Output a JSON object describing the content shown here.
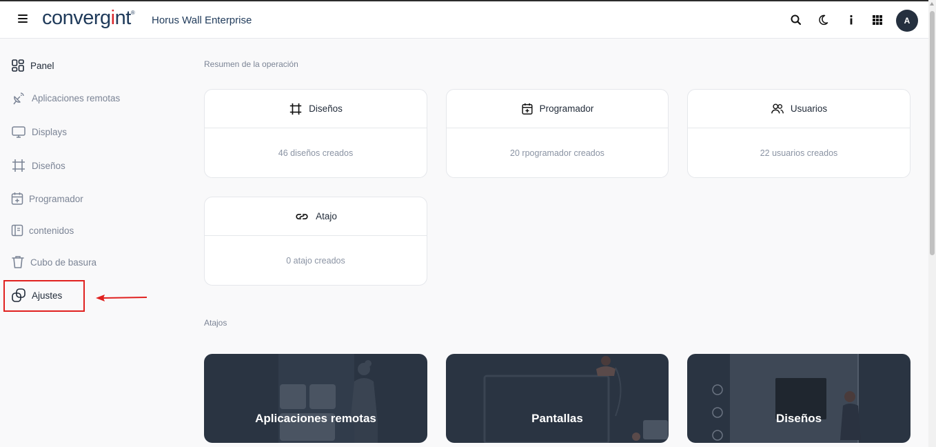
{
  "header": {
    "logo_prefix": "converg",
    "logo_accent": "i",
    "logo_suffix": "nt",
    "logo_mark": "®",
    "app_title": "Horus Wall Enterprise",
    "avatar_letter": "A"
  },
  "sidebar": {
    "items": [
      {
        "label": "Panel",
        "icon": "dashboard-icon"
      },
      {
        "label": "Aplicaciones remotas",
        "icon": "satellite-dish-icon"
      },
      {
        "label": "Displays",
        "icon": "monitor-icon"
      },
      {
        "label": "Diseños",
        "icon": "crop-frame-icon"
      },
      {
        "label": "Programador",
        "icon": "calendar-plus-icon"
      },
      {
        "label": "contenidos",
        "icon": "content-panel-icon"
      },
      {
        "label": "Cubo de basura",
        "icon": "trash-icon"
      },
      {
        "label": "Ajustes",
        "icon": "settings-overlap-icon"
      }
    ]
  },
  "main": {
    "summary_title": "Resumen de la operación",
    "cards": [
      {
        "title": "Diseños",
        "value": "46 diseños creados",
        "icon": "crop-frame-icon"
      },
      {
        "title": "Programador",
        "value": "20 rpogramador creados",
        "icon": "calendar-plus-icon"
      },
      {
        "title": "Usuarios",
        "value": "22 usuarios creados",
        "icon": "users-icon"
      },
      {
        "title": "Atajo",
        "value": "0 atajo creados",
        "icon": "link-icon"
      }
    ],
    "shortcuts_title": "Atajos",
    "shortcuts": [
      {
        "label": "Aplicaciones remotas"
      },
      {
        "label": "Pantallas"
      },
      {
        "label": "Diseños"
      }
    ]
  },
  "colors": {
    "accent_red": "#e0201e",
    "brand_navy": "#1f3a5a",
    "shortcut_bg": "#2a3442"
  }
}
